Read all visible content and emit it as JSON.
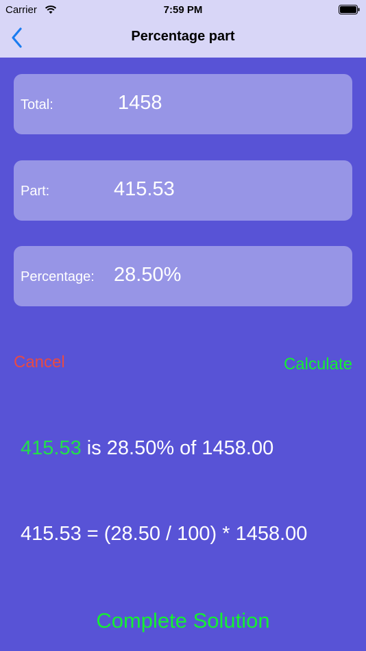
{
  "status_bar": {
    "carrier": "Carrier",
    "time": "7:59 PM"
  },
  "nav": {
    "title": "Percentage part",
    "back_icon": "chevron-left-icon"
  },
  "fields": {
    "total": {
      "label": "Total:",
      "value": "1458"
    },
    "part": {
      "label": "Part:",
      "value": "415.53"
    },
    "percentage": {
      "label": "Percentage:",
      "value": "28.50%"
    }
  },
  "actions": {
    "cancel": "Cancel",
    "calculate": "Calculate",
    "complete_solution": "Complete Solution"
  },
  "result": {
    "part_value": "415.53",
    "statement_rest": " is 28.50% of 1458.00",
    "formula": "415.53 = (28.50 / 100) * 1458.00"
  },
  "colors": {
    "background": "#5853d6",
    "topbar": "#d8d6f7",
    "field_bg": "#9795e6",
    "cancel": "#e84a44",
    "green": "#14f032",
    "back_icon": "#1a7cf0"
  }
}
